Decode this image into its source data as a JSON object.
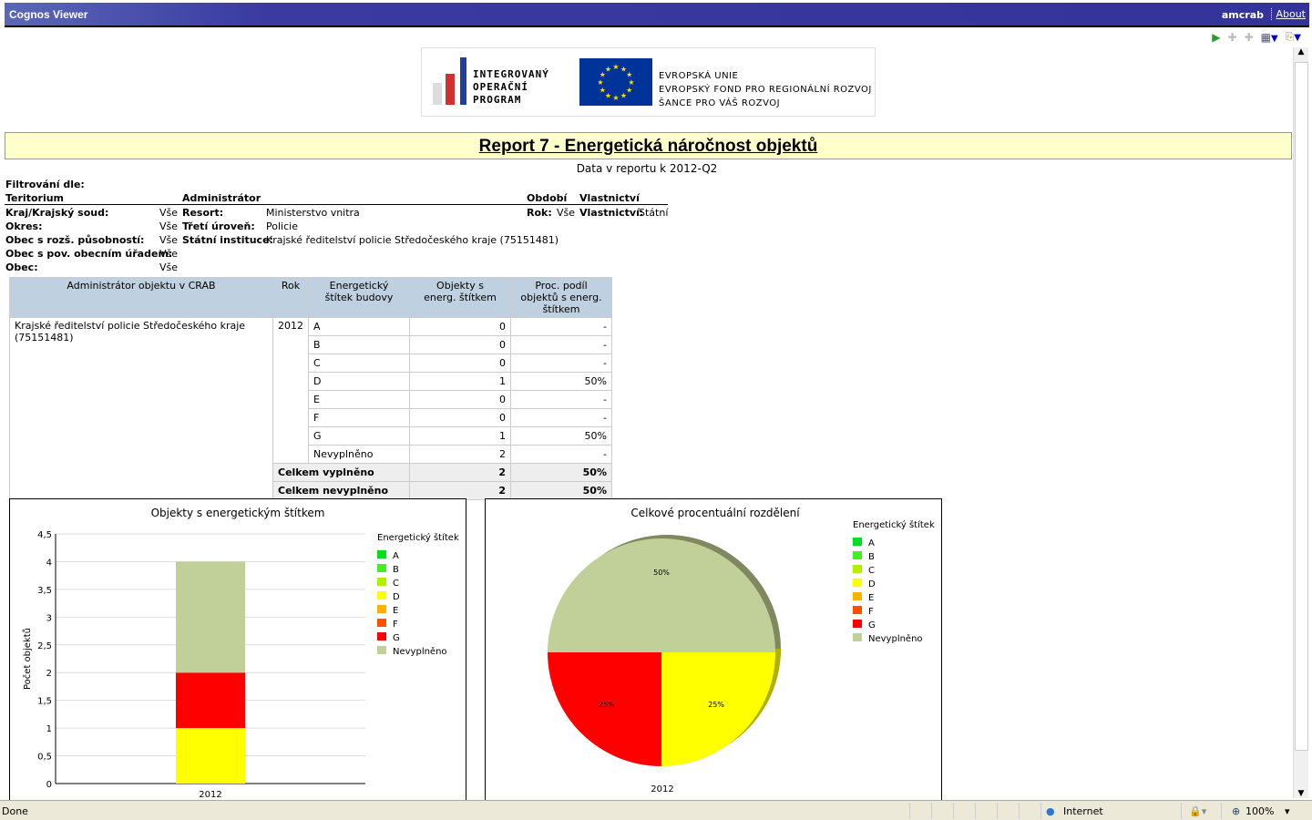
{
  "app": {
    "title": "Cognos Viewer",
    "user": "amcrab",
    "about": "About"
  },
  "toolbar": {
    "icons": [
      "run-icon",
      "drill-down-icon",
      "drill-up-icon",
      "related-links-icon",
      "return-icon"
    ]
  },
  "logo": {
    "iop_lines": [
      "INTEGROVANÝ",
      "OPERAČNÍ",
      "PROGRAM"
    ],
    "eu_lines": [
      "EVROPSKÁ UNIE",
      "EVROPSKÝ FOND PRO REGIONÁLNÍ ROZVOJ",
      "ŠANCE PRO VÁŠ ROZVOJ"
    ]
  },
  "report": {
    "title": "Report 7 - Energetická náročnost objektů",
    "subtitle": "Data v reportu k 2012-Q2"
  },
  "filters": {
    "heading": "Filtrování dle:",
    "territory": {
      "title": "Teritorium",
      "rows": [
        [
          "Kraj/Krajský soud:",
          "Vše"
        ],
        [
          "Okres:",
          "Vše"
        ],
        [
          "Obec s rozš. působností:",
          "Vše"
        ],
        [
          "Obec s pov. obecním úřadem:",
          "Vše"
        ],
        [
          "Obec:",
          "Vše"
        ]
      ]
    },
    "admin": {
      "title": "Administrátor",
      "rows": [
        [
          "Resort:",
          "Ministerstvo vnitra"
        ],
        [
          "Třetí úroveň:",
          "Policie"
        ],
        [
          "Státní instituce:",
          "Krajské ředitelství policie Středočeského kraje (75151481)"
        ]
      ]
    },
    "period": {
      "title": "Období",
      "label": "Rok:",
      "value": "Vše"
    },
    "ownership": {
      "title": "Vlastnictví",
      "label": "Vlastnictví:",
      "value": "Státní"
    }
  },
  "table": {
    "headers": [
      "Administrátor objektu v CRAB",
      "Rok",
      "Energetický štítek budovy",
      "Objekty s energ. štítkem",
      "Proc. podíl objektů s energ. štítkem"
    ],
    "admin": "Krajské ředitelství policie Středočeského kraje (75151481)",
    "year": "2012",
    "rows": [
      [
        "A",
        "0",
        "-"
      ],
      [
        "B",
        "0",
        "-"
      ],
      [
        "C",
        "0",
        "-"
      ],
      [
        "D",
        "1",
        "50%"
      ],
      [
        "E",
        "0",
        "-"
      ],
      [
        "F",
        "0",
        "-"
      ],
      [
        "G",
        "1",
        "50%"
      ],
      [
        "Nevyplněno",
        "2",
        "-"
      ]
    ],
    "totals": [
      [
        "Celkem vyplněno",
        "2",
        "50%"
      ],
      [
        "Celkem nevyplněno",
        "2",
        "50%"
      ]
    ]
  },
  "legend": {
    "title": "Energetický štítek",
    "items": [
      {
        "label": "A",
        "color": "#00e020"
      },
      {
        "label": "B",
        "color": "#40f020"
      },
      {
        "label": "C",
        "color": "#b0f000"
      },
      {
        "label": "D",
        "color": "#ffff00"
      },
      {
        "label": "E",
        "color": "#ffb000"
      },
      {
        "label": "F",
        "color": "#ff5000"
      },
      {
        "label": "G",
        "color": "#ff0000"
      },
      {
        "label": "Nevyplněno",
        "color": "#c0d098"
      }
    ]
  },
  "chart_data": [
    {
      "type": "bar",
      "stacked": true,
      "title": "Objekty s energetickým štítkem",
      "ylabel": "Počet objektů",
      "xlabel": "",
      "categories": [
        "2012"
      ],
      "ylim": [
        0,
        4.5
      ],
      "yticks": [
        "0",
        "0,5",
        "1",
        "1,5",
        "2",
        "2,5",
        "3",
        "3,5",
        "4",
        "4,5"
      ],
      "grid": true,
      "legend": "right",
      "series": [
        {
          "name": "A",
          "values": [
            0
          ]
        },
        {
          "name": "B",
          "values": [
            0
          ]
        },
        {
          "name": "C",
          "values": [
            0
          ]
        },
        {
          "name": "D",
          "values": [
            1
          ]
        },
        {
          "name": "E",
          "values": [
            0
          ]
        },
        {
          "name": "F",
          "values": [
            0
          ]
        },
        {
          "name": "G",
          "values": [
            1
          ]
        },
        {
          "name": "Nevyplněno",
          "values": [
            2
          ]
        }
      ]
    },
    {
      "type": "pie",
      "title": "Celkové procentuální rozdělení",
      "category": "2012",
      "legend": "right",
      "slices": [
        {
          "name": "Nevyplněno",
          "value": 50,
          "label": "50%"
        },
        {
          "name": "D",
          "value": 25,
          "label": "25%"
        },
        {
          "name": "G",
          "value": 25,
          "label": "25%"
        }
      ]
    }
  ],
  "status": {
    "left": "Done",
    "zone": "Internet",
    "zoom": "100%"
  }
}
